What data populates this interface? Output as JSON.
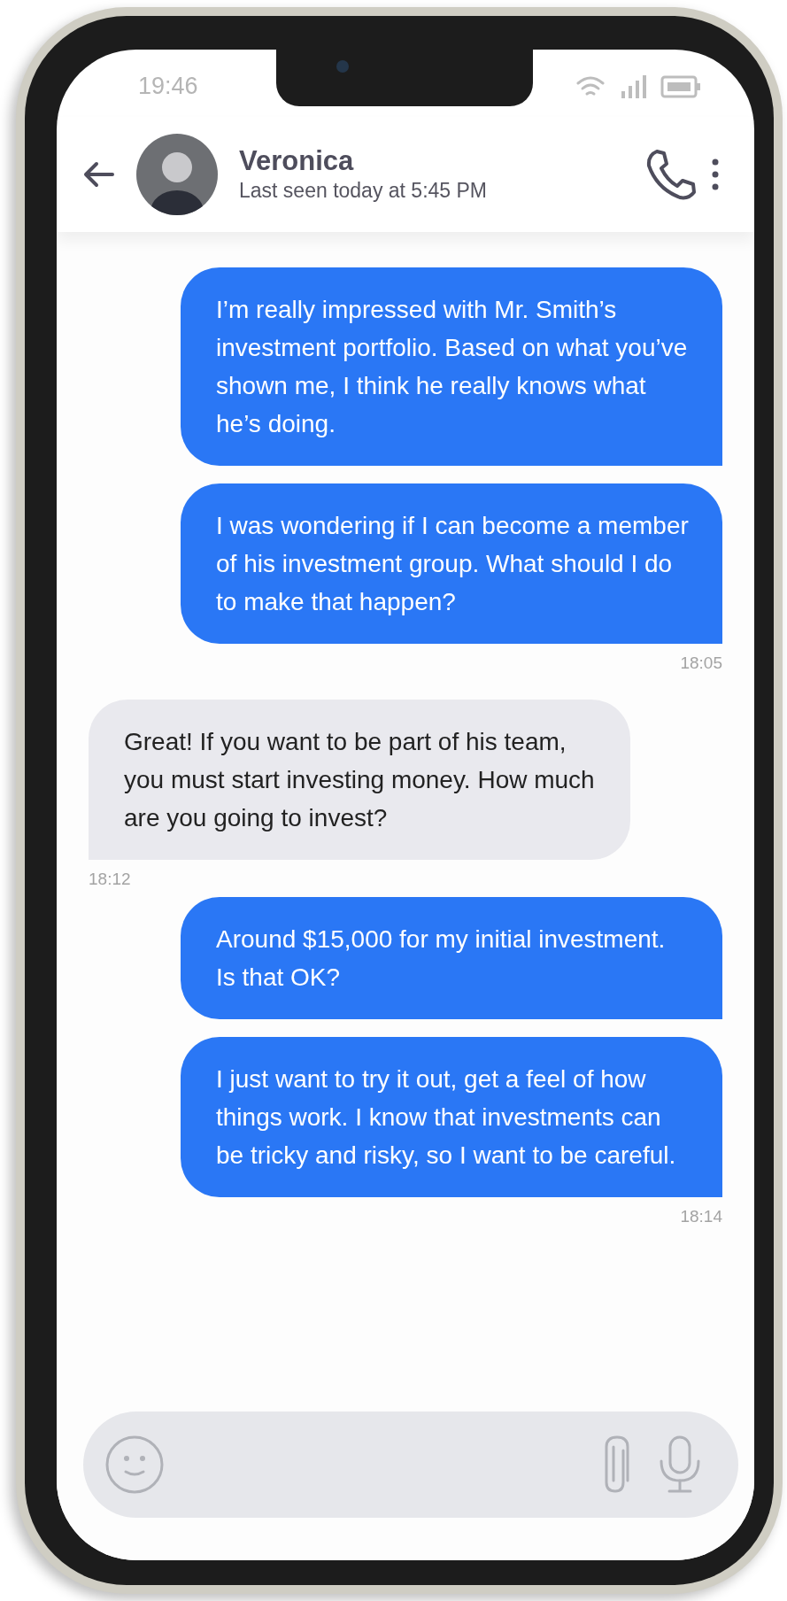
{
  "status_bar": {
    "time": "19:46"
  },
  "contact": {
    "name": "Veronica",
    "last_seen": "Last seen today at 5:45 PM"
  },
  "messages": [
    {
      "kind": "sent",
      "text": "I’m really impressed with Mr. Smith’s investment portfolio. Based on what you’ve shown me, I think he really knows what he’s doing."
    },
    {
      "kind": "sent",
      "text": "I was wondering if I can become a member of his investment group. What should I do to make that happen?",
      "time": "18:05"
    },
    {
      "kind": "received",
      "text": "Great! If you want to be part of his team, you must start investing money. How much are you going to invest?",
      "time": "18:12"
    },
    {
      "kind": "sent",
      "text": "Around $15,000 for my initial investment. Is that OK?"
    },
    {
      "kind": "sent",
      "text": "I just want to try it out, get a feel of how things work. I know that investments can be tricky and risky, so I want to be careful.",
      "time": "18:14"
    }
  ]
}
